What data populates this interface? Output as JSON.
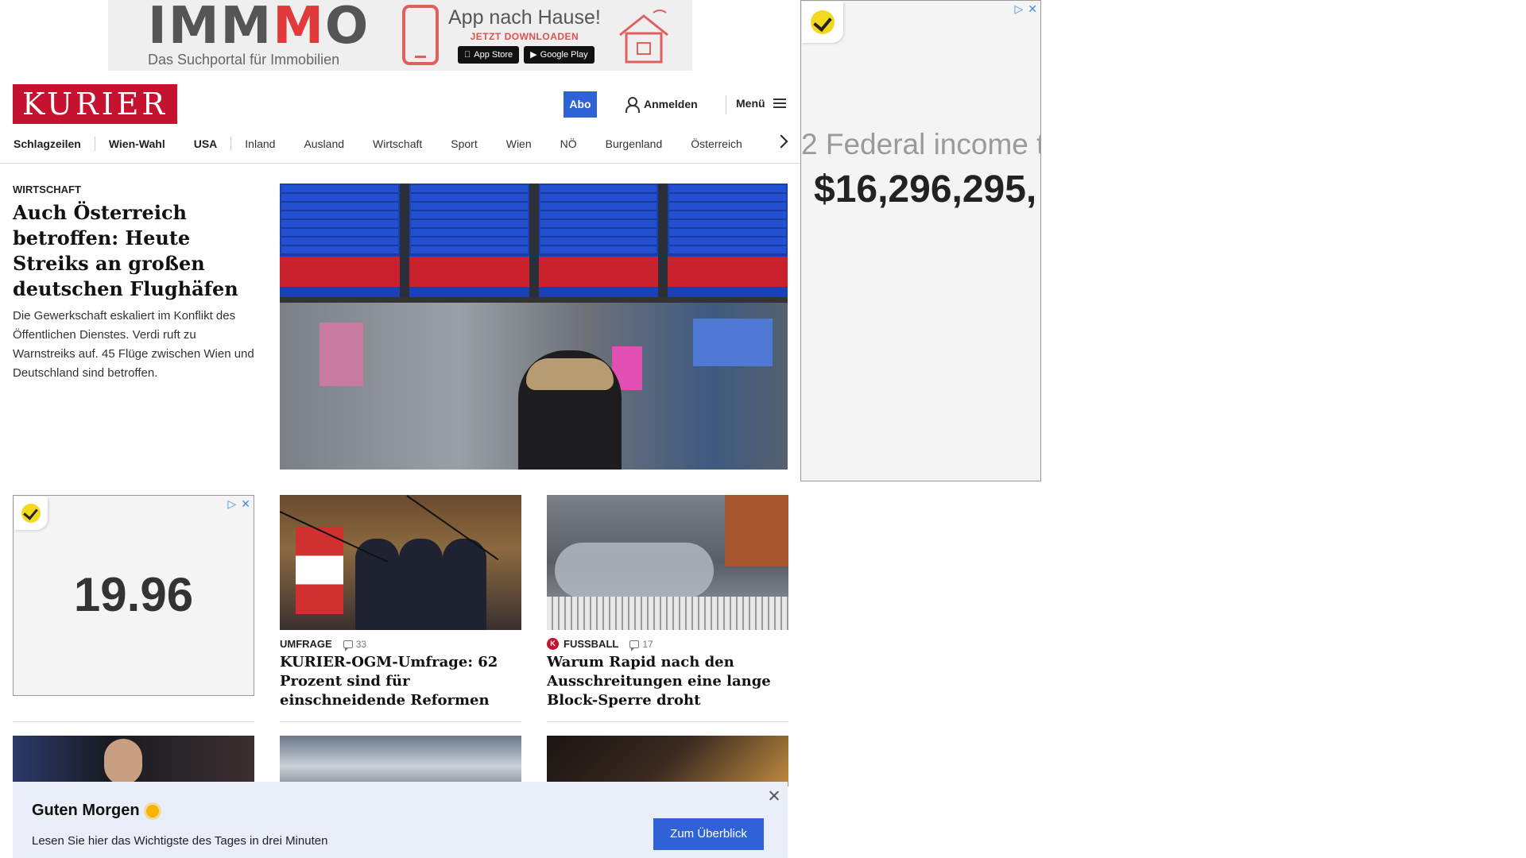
{
  "top_ad": {
    "brand_prefix": "IMM",
    "brand_red": "M",
    "brand_suffix": "O",
    "tagline": "Das Suchportal für Immobilien",
    "app_title": "App nach Hause!",
    "app_sub": "JETZT DOWNLOADEN",
    "app_store": "App Store",
    "google_play": "Google Play"
  },
  "right_ad": {
    "line1": "2   Federal income t",
    "amount": "$16,296,295,"
  },
  "header": {
    "logo": "KURIER",
    "abo": "Abo",
    "login": "Anmelden",
    "menu": "Menü"
  },
  "nav": {
    "items": [
      "Schlagzeilen",
      "Wien-Wahl",
      "USA",
      "Inland",
      "Ausland",
      "Wirtschaft",
      "Sport",
      "Wien",
      "NÖ",
      "Burgenland",
      "Österreich"
    ]
  },
  "lead": {
    "category": "WIRTSCHAFT",
    "title": "Auch Österreich betroffen: Heute Streiks an großen deutschen Flughäfen",
    "text": "Die Gewerkschaft eskaliert im Konflikt des Öffentlichen Dienstes. Verdi ruft zu Warnstreiks auf. 45 Flüge zwischen Wien und Deutschland sind betroffen."
  },
  "small_ad": {
    "value": "19.96"
  },
  "teasers": [
    {
      "category": "UMFRAGE",
      "comments": "33",
      "title": "KURIER-OGM-Umfrage: 62 Prozent sind für einschneidende Reformen"
    },
    {
      "category": "FUSSBALL",
      "comments": "17",
      "title": "Warum Rapid nach den Ausschreitungen eine lange Block-Sperre droht"
    }
  ],
  "toast": {
    "title": "Guten Morgen",
    "text": "Lesen Sie hier das Wichtigste des Tages in drei Minuten",
    "button": "Zum Überblick"
  },
  "colors": {
    "brand_red": "#c4122f",
    "accent_blue": "#2f62d6",
    "toast_bg": "#e9eef8"
  }
}
